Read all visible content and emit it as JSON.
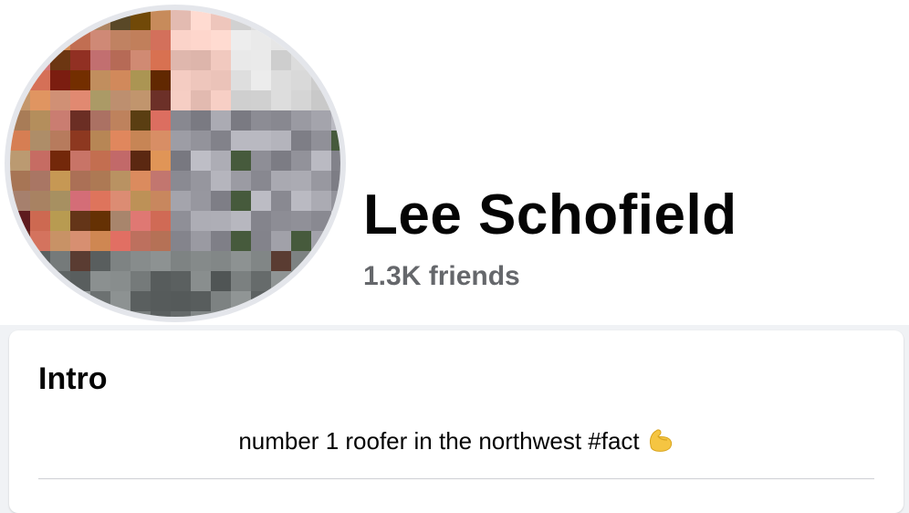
{
  "profile": {
    "name": "Lee Schofield",
    "friends": "1.3K friends",
    "avatar_icon": "profile-photo-pixelated"
  },
  "intro": {
    "title": "Intro",
    "bio_text": "number 1 roofer in the northwest #fact",
    "bio_emoji_icon": "flexed-biceps-icon"
  },
  "colors": {
    "page_bg": "#f0f2f5",
    "card_bg": "#ffffff",
    "primary_text": "#050505",
    "secondary_text": "#65676b",
    "divider": "#ced0d4"
  }
}
